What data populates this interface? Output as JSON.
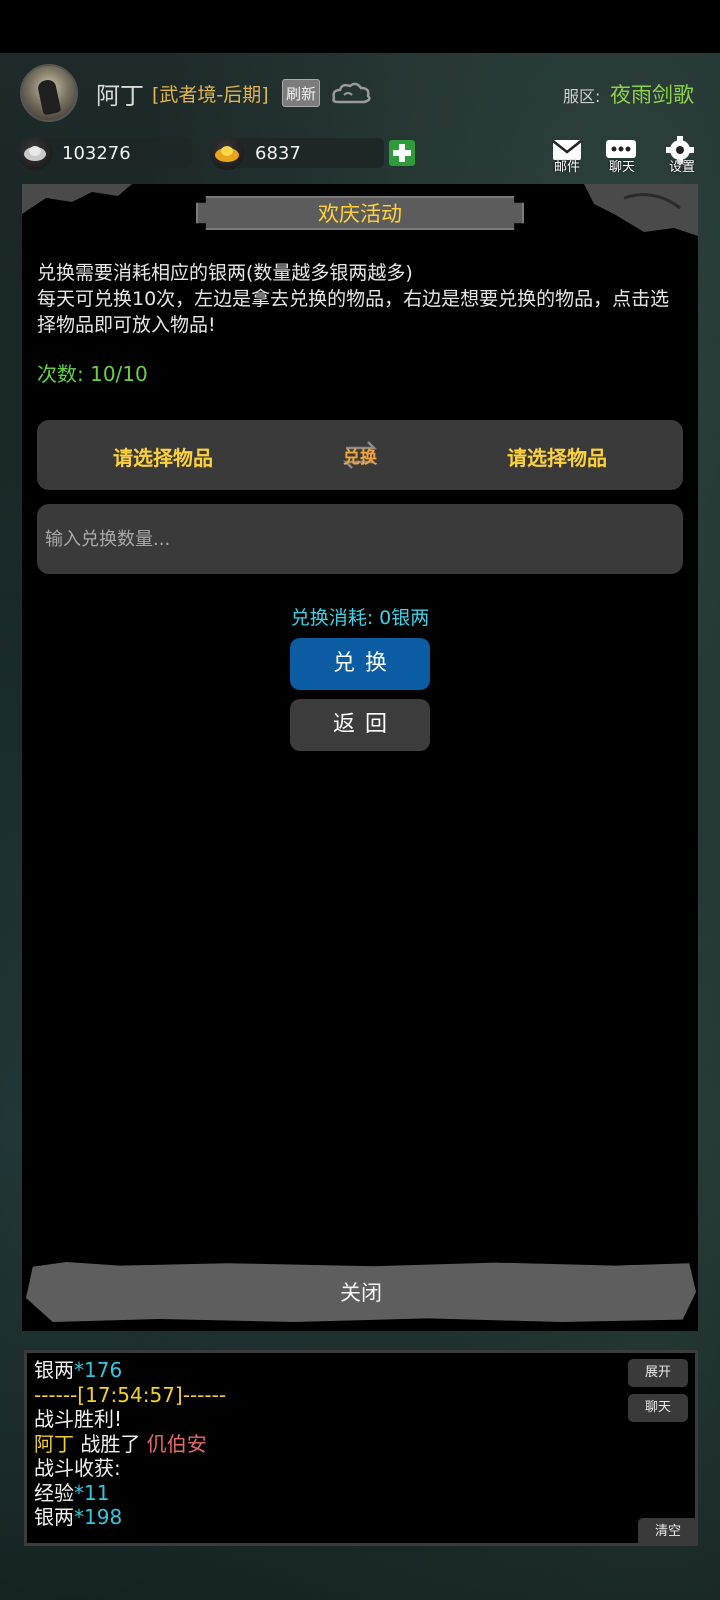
{
  "header": {
    "player_name": "阿丁",
    "player_realm": "[武者境-后期]",
    "refresh_label": "刷新",
    "server_label": "服区:",
    "server_name": "夜雨剑歌"
  },
  "currency": {
    "silver": "103276",
    "gold": "6837"
  },
  "top_icons": {
    "mail_label": "邮件",
    "chat_label": "聊天",
    "settings_label": "设置"
  },
  "modal": {
    "title": "欢庆活动",
    "description": "兑换需要消耗相应的银两(数量越多银两越多)\n每天可兑换10次，左边是拿去兑换的物品，右边是想要兑换的物品，点击选择物品即可放入物品!",
    "count_label": "次数: 10/10",
    "select_left": "请选择物品",
    "swap_label": "兑换",
    "select_right": "请选择物品",
    "quantity_placeholder": "输入兑换数量...",
    "cost_text": "兑换消耗: 0银两",
    "exchange_button": "兑换",
    "back_button": "返回",
    "close_label": "关闭"
  },
  "log": {
    "lines": [
      {
        "parts": [
          {
            "text": "银两",
            "color": "white"
          },
          {
            "text": "*176",
            "color": "cyan"
          }
        ]
      },
      {
        "parts": [
          {
            "text": "------[17:54:57]------",
            "color": "yellow"
          }
        ]
      },
      {
        "parts": [
          {
            "text": "战斗胜利!",
            "color": "white"
          }
        ]
      },
      {
        "parts": [
          {
            "text": "阿丁",
            "color": "yellow"
          },
          {
            "text": " 战胜了 ",
            "color": "white"
          },
          {
            "text": "仉伯安",
            "color": "red"
          }
        ]
      },
      {
        "parts": [
          {
            "text": "战斗收获:",
            "color": "white"
          }
        ]
      },
      {
        "parts": [
          {
            "text": "经验",
            "color": "white"
          },
          {
            "text": "*11",
            "color": "cyan"
          }
        ]
      },
      {
        "parts": [
          {
            "text": "银两",
            "color": "white"
          },
          {
            "text": "*198",
            "color": "cyan"
          }
        ]
      }
    ],
    "expand_button": "展开",
    "chat_button": "聊天",
    "clear_button": "清空"
  },
  "colors": {
    "accent_yellow": "#ffd23c",
    "count_green": "#66d148",
    "cost_cyan": "#3ed0e4",
    "exchange_blue": "#0b5ca2"
  }
}
